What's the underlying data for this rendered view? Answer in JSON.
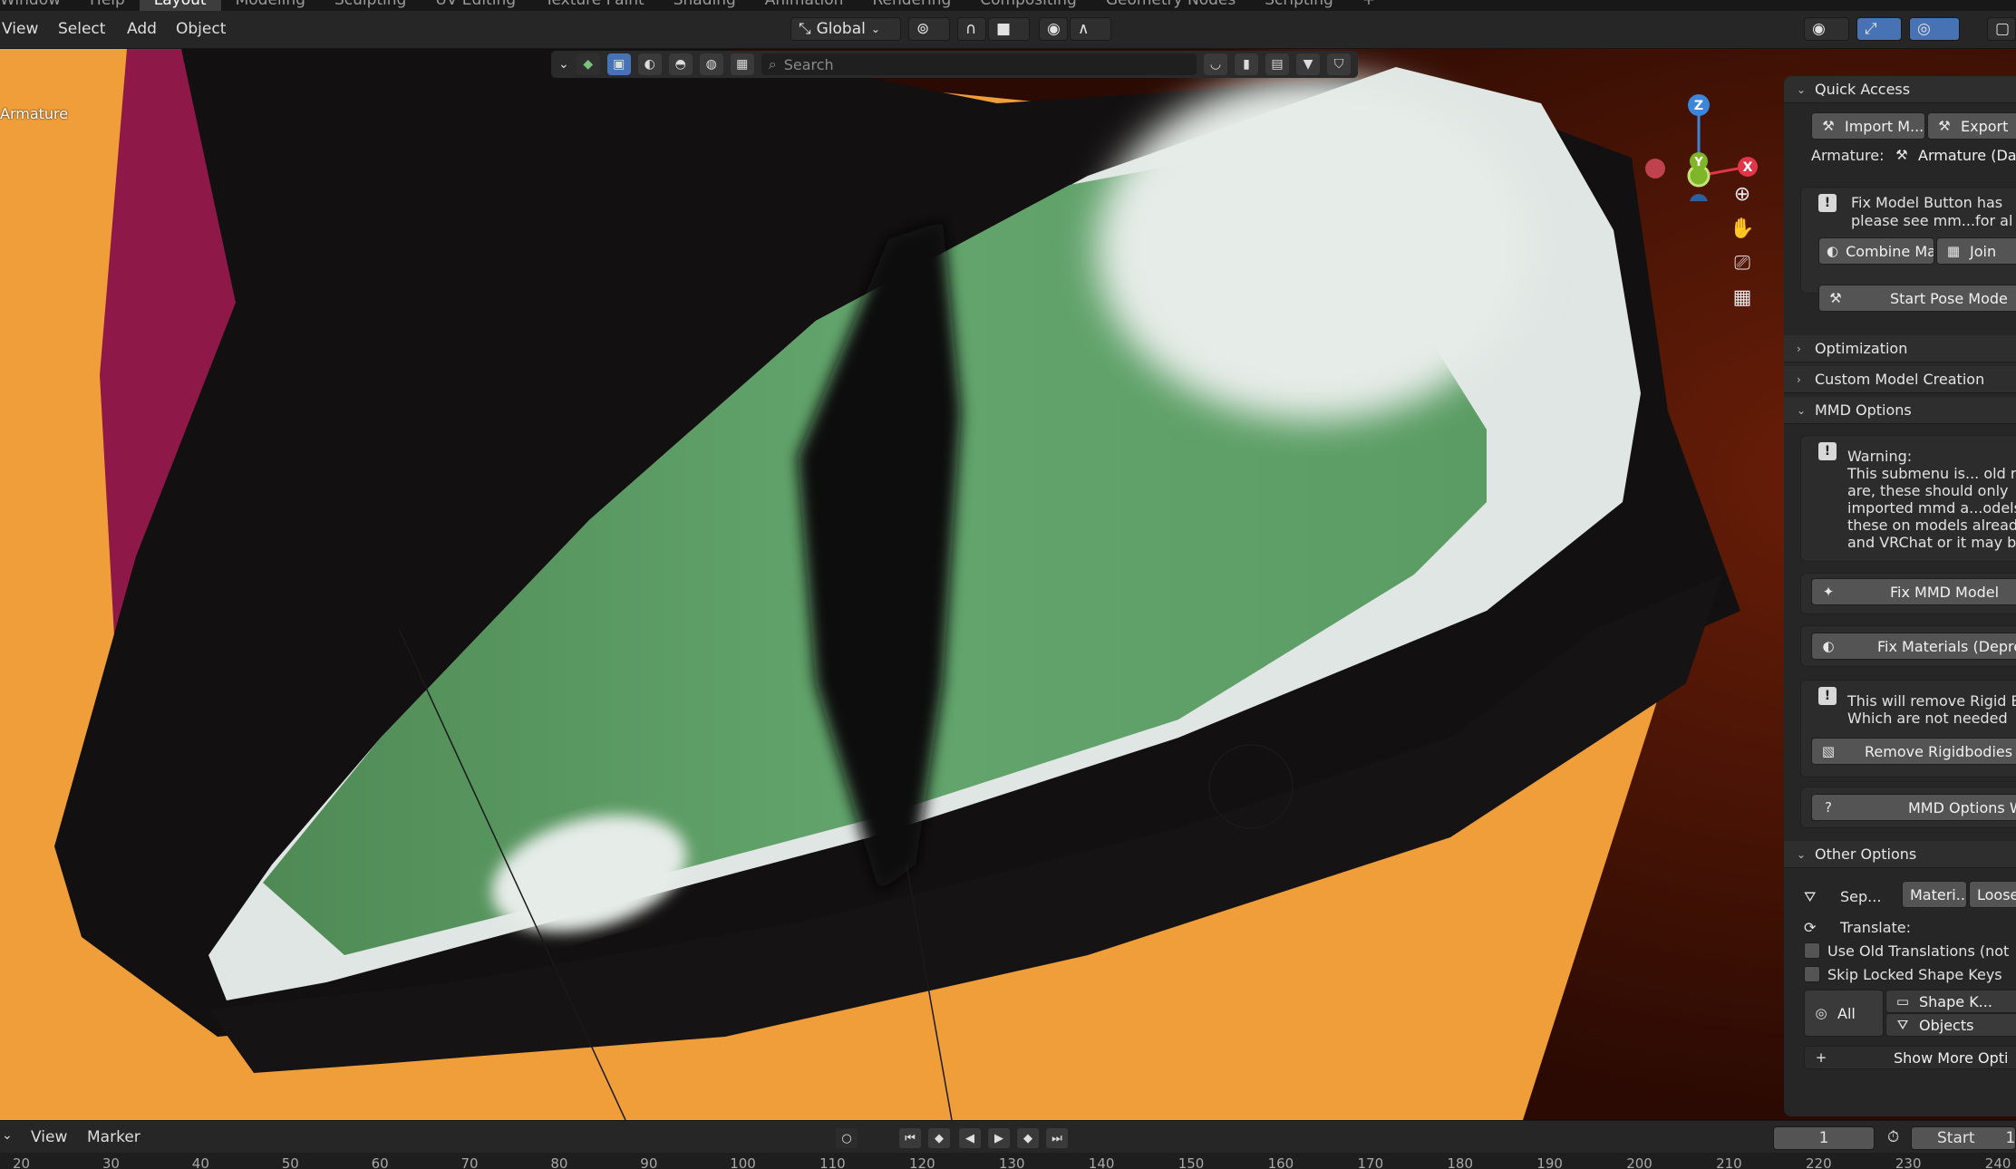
{
  "workspace_tabs": [
    "Window",
    "Help",
    "Layout",
    "Modeling",
    "Sculpting",
    "UV Editing",
    "Texture Paint",
    "Shading",
    "Animation",
    "Rendering",
    "Compositing",
    "Geometry Nodes",
    "Scripting",
    "+"
  ],
  "active_tab": "Layout",
  "menu": {
    "view": "View",
    "select": "Select",
    "add": "Add",
    "object": "Object"
  },
  "transform_orientation": "Global",
  "viewport": {
    "search_placeholder": "Search",
    "object_label": "Armature"
  },
  "gizmo": {
    "z": "Z",
    "y": "Y",
    "x": "X"
  },
  "panel": {
    "quick_access": {
      "title": "Quick Access",
      "import_label": "Import M...",
      "export_label": "Export",
      "armature_label": "Armature:",
      "armature_value": "Armature (Da",
      "info_line1": "Fix Model Button has",
      "info_line2": "please see mm...for al",
      "combine_label": "Combine Ma...",
      "join_label": "Join",
      "pose_label": "Start Pose Mode"
    },
    "optimization": "Optimization",
    "custom_model": "Custom Model Creation",
    "mmd_options": {
      "title": "MMD Options",
      "warning": "Warning:",
      "w1": "This submenu is... old r",
      "w2": "are, these should only",
      "w3": "imported mmd a...odels",
      "w4": "these on models alread",
      "w5": "and VRChat or it may b",
      "fix_mmd": "Fix MMD Model",
      "fix_materials": "Fix Materials (Depre",
      "remove_info1": "This will remove Rigid B",
      "remove_info2": "Which are not needed",
      "remove_rigid": "Remove Rigidbodies a",
      "mmd_options_w": "MMD Options W"
    },
    "other_options": {
      "title": "Other Options",
      "sep": "Sep...",
      "materi": "Materi...",
      "loose": "Loose",
      "translate": "Translate:",
      "use_old": "Use Old Translations (not",
      "skip_locked": "Skip Locked Shape Keys",
      "all": "All",
      "shape_keys": "Shape K...",
      "objects": "Objects",
      "show_more": "Show More Opti"
    }
  },
  "timeline": {
    "view": "View",
    "marker": "Marker",
    "current_frame": "1",
    "start_label": "Start",
    "start_value": "1",
    "ruler": [
      "20",
      "30",
      "40",
      "50",
      "60",
      "70",
      "80",
      "90",
      "100",
      "110",
      "120",
      "130",
      "140",
      "150",
      "160",
      "170",
      "180",
      "190",
      "200",
      "210",
      "220",
      "230",
      "240"
    ]
  },
  "colors": {
    "accent_blue": "#4772b3",
    "skin_orange": "#ef9e3a",
    "iris_green": "#5c9f66",
    "hair_magenta": "#8e1847",
    "axis_x": "#e0364a",
    "axis_y": "#7fb629",
    "axis_z": "#3d85d8"
  }
}
